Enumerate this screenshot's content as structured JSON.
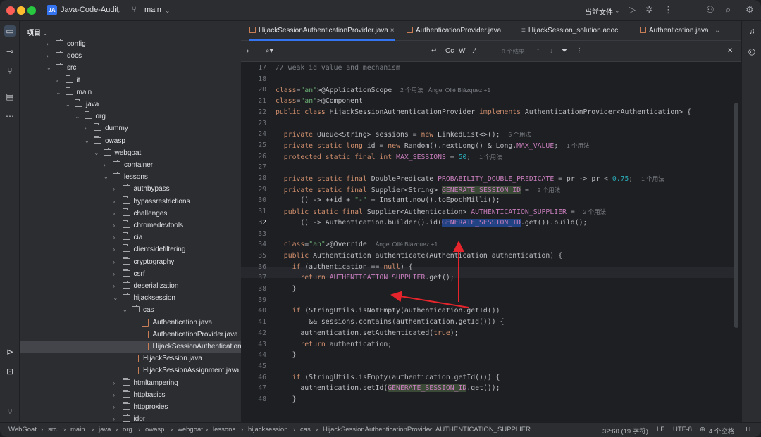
{
  "title_bar": {
    "project_badge": "JA",
    "project_name": "Java-Code-Audit",
    "branch": "main",
    "current_file": "当前文件",
    "icons": [
      "run-icon",
      "debug-icon",
      "more-icon",
      "add-user-icon",
      "search-icon",
      "settings-icon"
    ]
  },
  "project_panel": {
    "header": "项目",
    "tree": [
      {
        "label": "config",
        "type": "folder",
        "depth": 1,
        "expanded": false
      },
      {
        "label": "docs",
        "type": "folder",
        "depth": 1,
        "expanded": false
      },
      {
        "label": "src",
        "type": "folder",
        "depth": 1,
        "expanded": true
      },
      {
        "label": "it",
        "type": "folder",
        "depth": 2,
        "expanded": false
      },
      {
        "label": "main",
        "type": "folder",
        "depth": 2,
        "expanded": true
      },
      {
        "label": "java",
        "type": "folder",
        "depth": 3,
        "expanded": true
      },
      {
        "label": "org",
        "type": "folder",
        "depth": 4,
        "expanded": true
      },
      {
        "label": "dummy",
        "type": "folder",
        "depth": 5,
        "expanded": false
      },
      {
        "label": "owasp",
        "type": "folder",
        "depth": 5,
        "expanded": true
      },
      {
        "label": "webgoat",
        "type": "folder",
        "depth": 6,
        "expanded": true
      },
      {
        "label": "container",
        "type": "folder",
        "depth": 7,
        "expanded": false
      },
      {
        "label": "lessons",
        "type": "folder",
        "depth": 7,
        "expanded": true
      },
      {
        "label": "authbypass",
        "type": "folder",
        "depth": 8,
        "expanded": false
      },
      {
        "label": "bypassrestrictions",
        "type": "folder",
        "depth": 8,
        "expanded": false
      },
      {
        "label": "challenges",
        "type": "folder",
        "depth": 8,
        "expanded": false
      },
      {
        "label": "chromedevtools",
        "type": "folder",
        "depth": 8,
        "expanded": false
      },
      {
        "label": "cia",
        "type": "folder",
        "depth": 8,
        "expanded": false
      },
      {
        "label": "clientsidefiltering",
        "type": "folder",
        "depth": 8,
        "expanded": false
      },
      {
        "label": "cryptography",
        "type": "folder",
        "depth": 8,
        "expanded": false
      },
      {
        "label": "csrf",
        "type": "folder",
        "depth": 8,
        "expanded": false
      },
      {
        "label": "deserialization",
        "type": "folder",
        "depth": 8,
        "expanded": false
      },
      {
        "label": "hijacksession",
        "type": "folder",
        "depth": 8,
        "expanded": true
      },
      {
        "label": "cas",
        "type": "folder",
        "depth": 9,
        "expanded": true
      },
      {
        "label": "Authentication.java",
        "type": "java",
        "depth": 10
      },
      {
        "label": "AuthenticationProvider.java",
        "type": "java",
        "depth": 10
      },
      {
        "label": "HijackSessionAuthenticationProvider.java",
        "type": "java",
        "depth": 10,
        "selected": true
      },
      {
        "label": "HijackSession.java",
        "type": "java",
        "depth": 9
      },
      {
        "label": "HijackSessionAssignment.java",
        "type": "java",
        "depth": 9
      },
      {
        "label": "htmltampering",
        "type": "folder",
        "depth": 8,
        "expanded": false
      },
      {
        "label": "httpbasics",
        "type": "folder",
        "depth": 8,
        "expanded": false
      },
      {
        "label": "httpproxies",
        "type": "folder",
        "depth": 8,
        "expanded": false
      },
      {
        "label": "idor",
        "type": "folder",
        "depth": 8,
        "expanded": false
      }
    ]
  },
  "tabs": [
    {
      "label": "HijackSessionAuthenticationProvider.java",
      "active": true,
      "kind": "java"
    },
    {
      "label": "AuthenticationProvider.java",
      "active": false,
      "kind": "java"
    },
    {
      "label": "HijackSession_solution.adoc",
      "active": false,
      "kind": "adoc"
    },
    {
      "label": "Authentication.java",
      "active": false,
      "kind": "java"
    }
  ],
  "find_bar": {
    "case_label": "Cc",
    "word_label": "W",
    "regex_label": ".*",
    "result_count": "0 个结果",
    "close_label": "关闭"
  },
  "code": {
    "current_line": "32",
    "lines": [
      {
        "n": "17",
        "text": "// weak id value and mechanism"
      },
      {
        "n": "18",
        "text": ""
      },
      {
        "n": "20",
        "text": "@ApplicationScope",
        "hint": "2 个用法   Àngel Ollé Blázquez +1"
      },
      {
        "n": "21",
        "text": "@Component"
      },
      {
        "n": "22",
        "text": "public class HijackSessionAuthenticationProvider implements AuthenticationProvider<Authentication> {"
      },
      {
        "n": "23",
        "text": ""
      },
      {
        "n": "24",
        "text": "  private Queue<String> sessions = new LinkedList<>();",
        "hint": "5 个用法"
      },
      {
        "n": "25",
        "text": "  private static long id = new Random().nextLong() & Long.MAX_VALUE;",
        "hint": "1 个用法"
      },
      {
        "n": "26",
        "text": "  protected static final int MAX_SESSIONS = 50;",
        "hint": "1 个用法"
      },
      {
        "n": "27",
        "text": ""
      },
      {
        "n": "28",
        "text": "  private static final DoublePredicate PROBABILITY_DOUBLE_PREDICATE = pr -> pr < 0.75;",
        "hint": "1 个用法"
      },
      {
        "n": "29",
        "text": "  private static final Supplier<String> GENERATE_SESSION_ID =",
        "hint": "2 个用法"
      },
      {
        "n": "30",
        "text": "      () -> ++id + \"-\" + Instant.now().toEpochMilli();"
      },
      {
        "n": "31",
        "text": "  public static final Supplier<Authentication> AUTHENTICATION_SUPPLIER =",
        "hint": "2 个用法"
      },
      {
        "n": "32",
        "text": "      () -> Authentication.builder().id(GENERATE_SESSION_ID.get()).build();"
      },
      {
        "n": "33",
        "text": ""
      },
      {
        "n": "34",
        "text": "  @Override",
        "hint": "Àngel Ollé Blázquez +1"
      },
      {
        "n": "35",
        "text": "  public Authentication authenticate(Authentication authentication) {"
      },
      {
        "n": "36",
        "text": "    if (authentication == null) {"
      },
      {
        "n": "37",
        "text": "      return AUTHENTICATION_SUPPLIER.get();"
      },
      {
        "n": "38",
        "text": "    }"
      },
      {
        "n": "39",
        "text": ""
      },
      {
        "n": "40",
        "text": "    if (StringUtils.isNotEmpty(authentication.getId())"
      },
      {
        "n": "41",
        "text": "        && sessions.contains(authentication.getId())) {"
      },
      {
        "n": "42",
        "text": "      authentication.setAuthenticated(true);"
      },
      {
        "n": "43",
        "text": "      return authentication;"
      },
      {
        "n": "44",
        "text": "    }"
      },
      {
        "n": "45",
        "text": ""
      },
      {
        "n": "46",
        "text": "    if (StringUtils.isEmpty(authentication.getId())) {"
      },
      {
        "n": "47",
        "text": "      authentication.setId(GENERATE_SESSION_ID.get());"
      },
      {
        "n": "48",
        "text": "    }"
      }
    ]
  },
  "status_bar": {
    "breadcrumb": [
      "WebGoat",
      "src",
      "main",
      "java",
      "org",
      "owasp",
      "webgoat",
      "lessons",
      "hijacksession",
      "cas",
      "HijackSessionAuthenticationProvider",
      "AUTHENTICATION_SUPPLIER"
    ],
    "position": "32:60 (19 字符)",
    "line_ending": "LF",
    "encoding": "UTF-8",
    "indent": "4 个空格"
  },
  "colors": {
    "accent": "#3574f0",
    "annotation_arrow": "#e5242b",
    "selection": "#214283"
  }
}
